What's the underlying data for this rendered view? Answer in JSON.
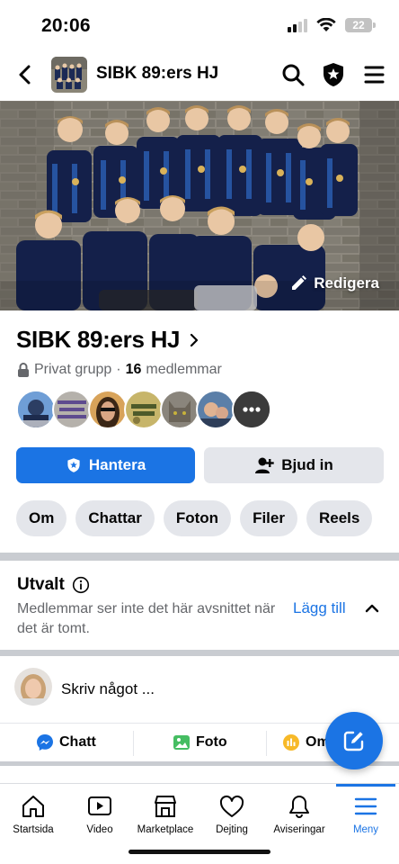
{
  "status_bar": {
    "time": "20:06",
    "battery": "22"
  },
  "topnav": {
    "title": "SIBK 89:ers HJ",
    "icons": [
      "back-icon",
      "search-icon",
      "admin-shield-icon",
      "menu-icon"
    ]
  },
  "cover": {
    "edit_label": "Redigera"
  },
  "group": {
    "name": "SIBK 89:ers HJ",
    "privacy": "Privat grupp",
    "separator": "·",
    "member_count": "16",
    "member_label": "medlemmar"
  },
  "buttons": {
    "manage": "Hantera",
    "invite": "Bjud in"
  },
  "tabs": [
    "Om",
    "Chattar",
    "Foton",
    "Filer",
    "Reels"
  ],
  "featured": {
    "title": "Utvalt",
    "description": "Medlemmar ser inte det här avsnittet när det är tomt.",
    "add_label": "Lägg till"
  },
  "composer": {
    "placeholder": "Skriv något ..."
  },
  "actions": [
    "Chatt",
    "Foto",
    "Om"
  ],
  "bottom_nav": [
    {
      "label": "Startsida",
      "icon": "home-icon"
    },
    {
      "label": "Video",
      "icon": "video-icon"
    },
    {
      "label": "Marketplace",
      "icon": "marketplace-icon"
    },
    {
      "label": "Dejting",
      "icon": "dating-heart-icon"
    },
    {
      "label": "Aviseringar",
      "icon": "bell-icon"
    },
    {
      "label": "Meny",
      "icon": "menu-icon",
      "active": true
    }
  ],
  "colors": {
    "accent": "#1b74e4",
    "chip_bg": "#e4e6eb",
    "muted_text": "#65676b",
    "divider": "#c9ccd1"
  }
}
